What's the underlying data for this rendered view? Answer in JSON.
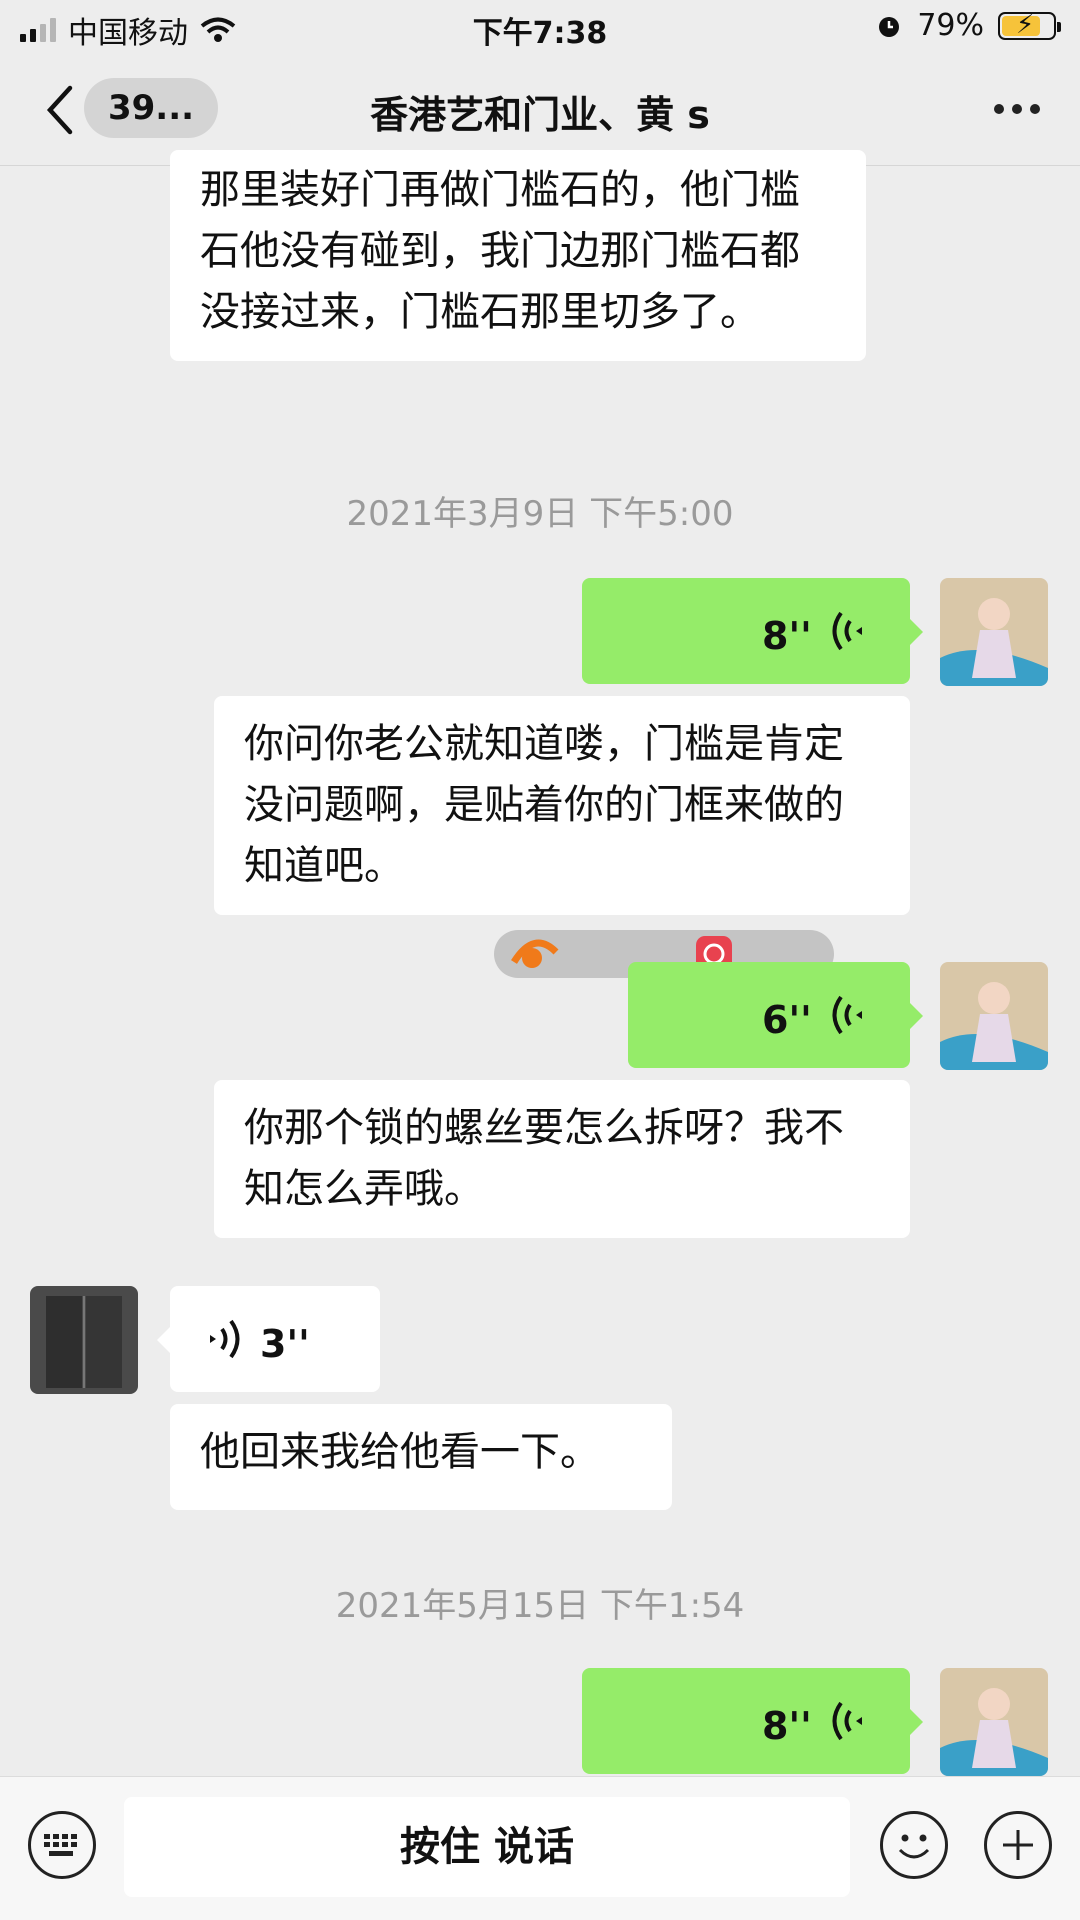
{
  "status_bar": {
    "carrier": "中国移动",
    "time": "下午7:38",
    "battery": "79%"
  },
  "nav": {
    "back_count": "39...",
    "title": "香港艺和门业、黄 s"
  },
  "messages": {
    "m1": "那里装好门再做门槛石的，他门槛石他没有碰到，我门边那门槛石都没接过来，门槛石那里切多了。",
    "ts1": "2021年3月9日 下午5:00",
    "v1": "8''",
    "m2": "你问你老公就知道喽，门槛是肯定没问题啊，是贴着你的门框来做的知道吧。",
    "v2": "6''",
    "m3": "你那个锁的螺丝要怎么拆呀？我不知怎么弄哦。",
    "v3": "3''",
    "m4": "他回来我给他看一下。",
    "ts2": "2021年5月15日 下午1:54",
    "v4": "8''"
  },
  "input_bar": {
    "hold_to_talk": "按住 说话"
  }
}
